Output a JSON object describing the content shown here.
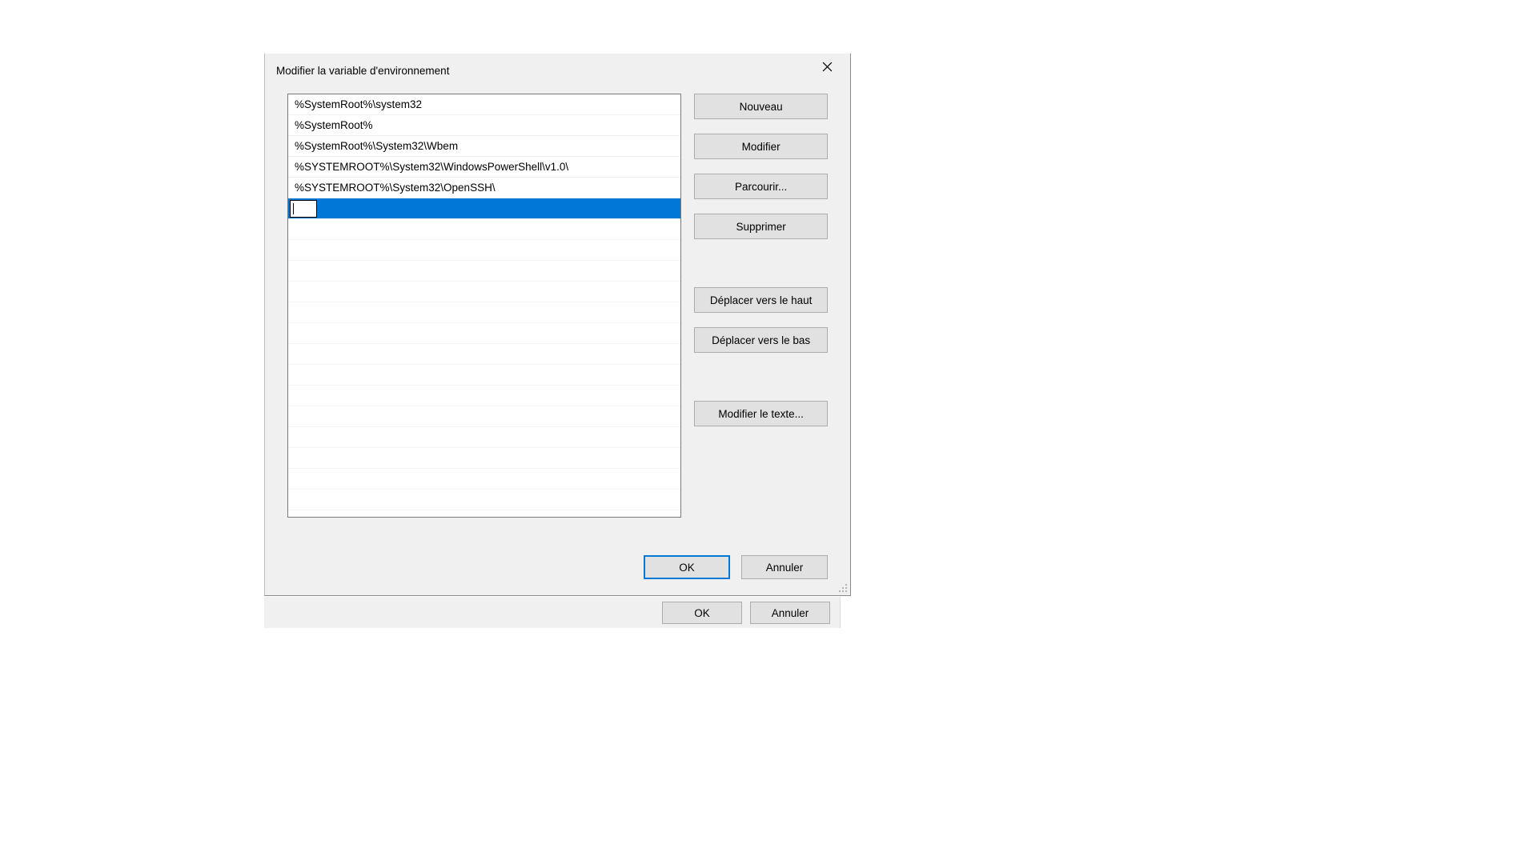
{
  "dialog": {
    "title": "Modifier la variable d'environnement",
    "entries": [
      "%SystemRoot%\\system32",
      "%SystemRoot%",
      "%SystemRoot%\\System32\\Wbem",
      "%SYSTEMROOT%\\System32\\WindowsPowerShell\\v1.0\\",
      "%SYSTEMROOT%\\System32\\OpenSSH\\"
    ],
    "editing_value": ""
  },
  "buttons": {
    "new": "Nouveau",
    "edit": "Modifier",
    "browse": "Parcourir...",
    "delete": "Supprimer",
    "move_up": "Déplacer vers le haut",
    "move_down": "Déplacer vers le bas",
    "edit_text": "Modifier le texte...",
    "ok": "OK",
    "cancel": "Annuler"
  },
  "parent_dialog": {
    "ok": "OK",
    "cancel": "Annuler"
  }
}
